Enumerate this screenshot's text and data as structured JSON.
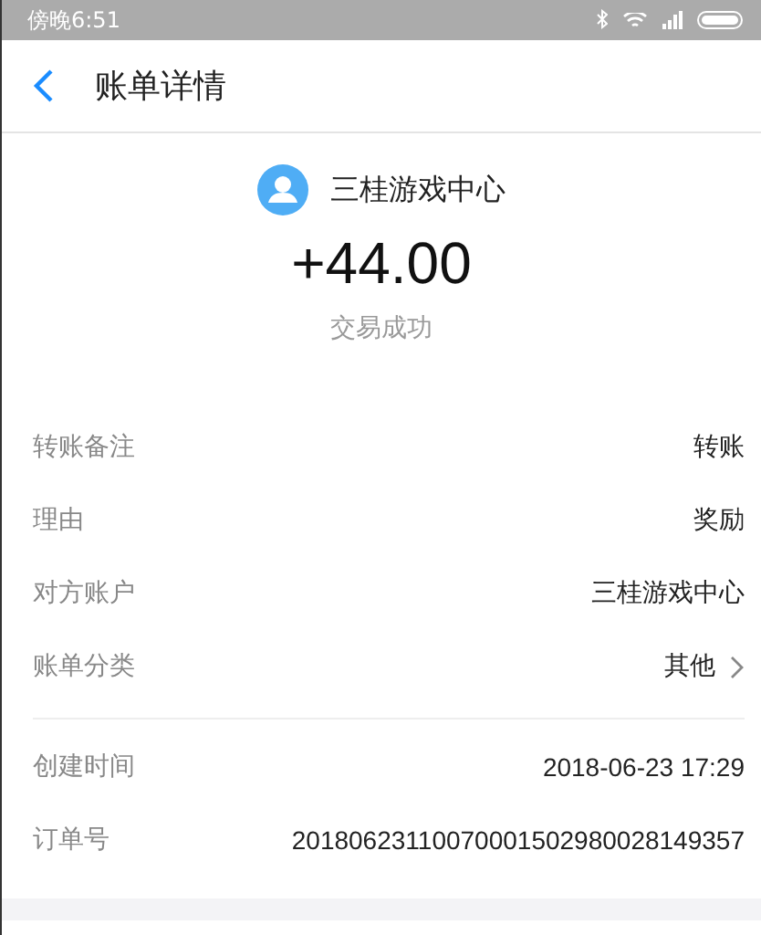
{
  "status_bar": {
    "time": "傍晚6:51"
  },
  "header": {
    "title": "账单详情"
  },
  "summary": {
    "payee": "三桂游戏中心",
    "amount": "+44.00",
    "status": "交易成功"
  },
  "sections": [
    {
      "rows": [
        {
          "label": "转账备注",
          "value": "转账",
          "kind": "plain"
        },
        {
          "label": "理由",
          "value": "奖励",
          "kind": "plain"
        },
        {
          "label": "对方账户",
          "value": "三桂游戏中心",
          "kind": "plain"
        },
        {
          "label": "账单分类",
          "value": "其他",
          "kind": "link"
        }
      ]
    },
    {
      "rows": [
        {
          "label": "创建时间",
          "value": "2018-06-23 17:29",
          "kind": "plain"
        },
        {
          "label": "订单号",
          "value": "20180623110070001502980028149357",
          "kind": "plain"
        }
      ]
    }
  ]
}
